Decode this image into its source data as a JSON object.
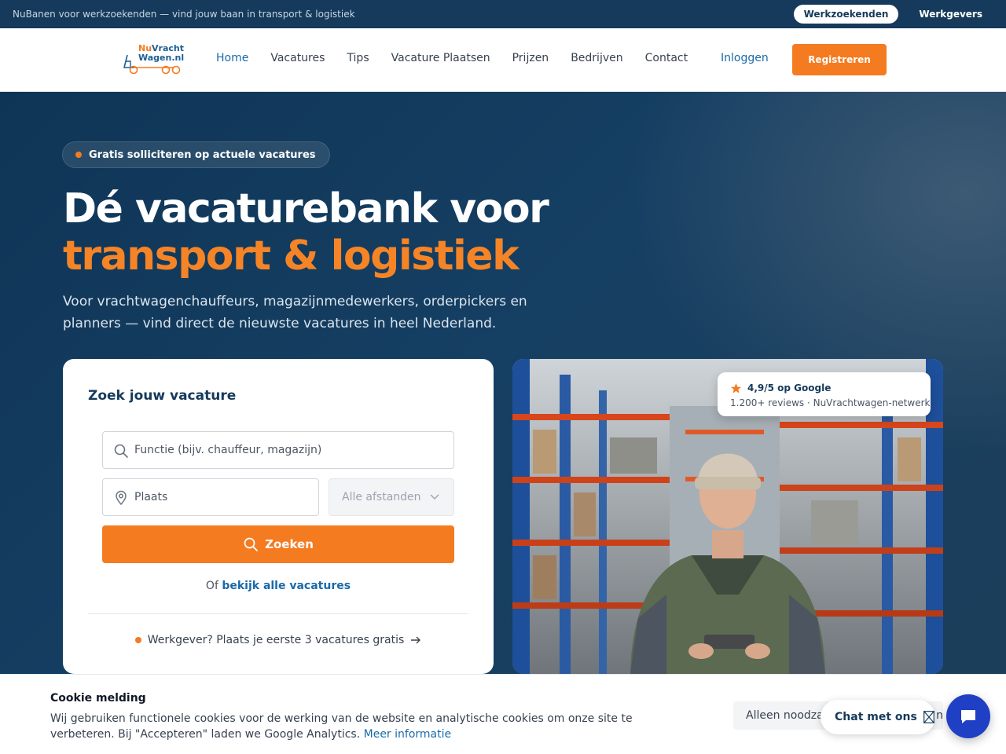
{
  "topbar": {
    "tagline": "NuBanen voor werkzoekenden — vind jouw baan in transport & logistiek",
    "audience_active": "Werkzoekenden",
    "audience_other": "Werkgevers"
  },
  "header": {
    "logo_line1_prefix": "Nu",
    "logo_line1": "Vracht",
    "logo_line2": "Wagen.nl",
    "nav": [
      "Home",
      "Vacatures",
      "Tips",
      "Vacature Plaatsen",
      "Prijzen",
      "Bedrijven",
      "Contact"
    ],
    "login": "Inloggen",
    "register": "Registreren"
  },
  "hero": {
    "badge": "Gratis solliciteren op actuele vacatures",
    "title_line1": "Dé vacaturebank voor",
    "title_line2": "transport & logistiek",
    "lead": "Voor vrachtwagenchauffeurs, magazijnmedewerkers, orderpickers en planners — vind direct de nieuwste vacatures in heel Nederland."
  },
  "search": {
    "title": "Zoek jouw vacature",
    "function_placeholder": "Functie (bijv. chauffeur, magazijn)",
    "place_placeholder": "Plaats",
    "distance_selected": "Alle afstanden",
    "button": "Zoeken",
    "alt_prefix": "Of ",
    "alt_link": "bekijk alle vacatures",
    "employer_cta": "Werkgever? Plaats je eerste 3 vacatures gratis"
  },
  "rating": {
    "score": "4,9/5 op Google",
    "detail": "1.200+ reviews · NuVrachtwagen-netwerk"
  },
  "cookie": {
    "title": "Cookie melding",
    "body": "Wij gebruiken functionele cookies voor de werking van de website en analytische cookies om onze site te verbeteren. Bij \"Accepteren\" laden we Google Analytics. ",
    "more": "Meer informatie",
    "necessary_button": "Alleen noodzakelijk",
    "accept_button_visible": "n"
  },
  "chat": {
    "label": "Chat met ons"
  },
  "colors": {
    "navy": "#153a5b",
    "orange": "#f47b20",
    "link_blue": "#1a6aa8",
    "chat_blue": "#1f3fc4"
  }
}
